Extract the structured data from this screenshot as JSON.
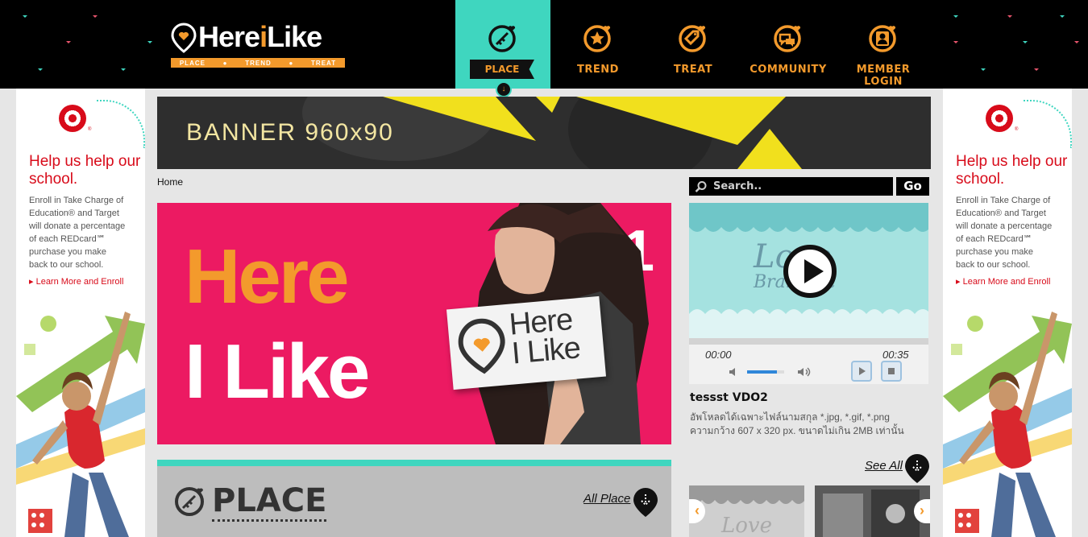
{
  "header": {
    "logo": {
      "text_before": "Here",
      "text_accent": "i",
      "text_after": "Like",
      "tagline_items": [
        "PLACE",
        "TREND",
        "TREAT"
      ]
    },
    "nav": [
      {
        "label": "PLACE",
        "icon": "place-icon",
        "active": true
      },
      {
        "label": "TREND",
        "icon": "trend-icon",
        "active": false
      },
      {
        "label": "TREAT",
        "icon": "treat-icon",
        "active": false
      },
      {
        "label": "COMMUNITY",
        "icon": "community-icon",
        "active": false
      },
      {
        "label": "MEMBER LOGIN",
        "icon": "member-icon",
        "active": false
      }
    ],
    "active_marker": "↓"
  },
  "side_ad": {
    "headline": "Help us help our school.",
    "body_line1": "Enroll in Take Charge of",
    "body_line2": "Education® and Target",
    "body_line3": "will donate a percentage",
    "body_line4": "of each REDcard℠",
    "body_line5": "purchase you make",
    "body_line6": "back to our school.",
    "learn_more": "Learn More and Enroll",
    "reg_mark": "®"
  },
  "banner": {
    "text": "BANNER 960x90"
  },
  "breadcrumb": {
    "home": "Home"
  },
  "hero": {
    "line1": "Here",
    "line2": "I Like",
    "slide_number": "1",
    "card_line1": "Here",
    "card_line2": "I Like"
  },
  "place_section": {
    "title": "PLACE",
    "all_link": "All Place"
  },
  "search": {
    "placeholder": "Search..",
    "go_label": "Go"
  },
  "video": {
    "title_art": "Love",
    "subtitle_art": "Brandset",
    "time_current": "00:00",
    "time_total": "00:35",
    "volume_level": 0.8,
    "caption": "tessst VDO2",
    "desc_line1": "อัพโหลดได้เฉพาะไฟล์นามสกุล *.jpg, *.gif, *.png",
    "desc_line2": "ความกว้าง 607 x 320 px. ขนาดไม่เกิน 2MB เท่านั้น",
    "see_all": "See All"
  },
  "carousel": {
    "prev": "‹",
    "next": "›"
  },
  "colors": {
    "accent_orange": "#f39a2c",
    "accent_teal": "#3fd6bf",
    "hero_pink": "#ec1a62",
    "target_red": "#d80b1a"
  }
}
